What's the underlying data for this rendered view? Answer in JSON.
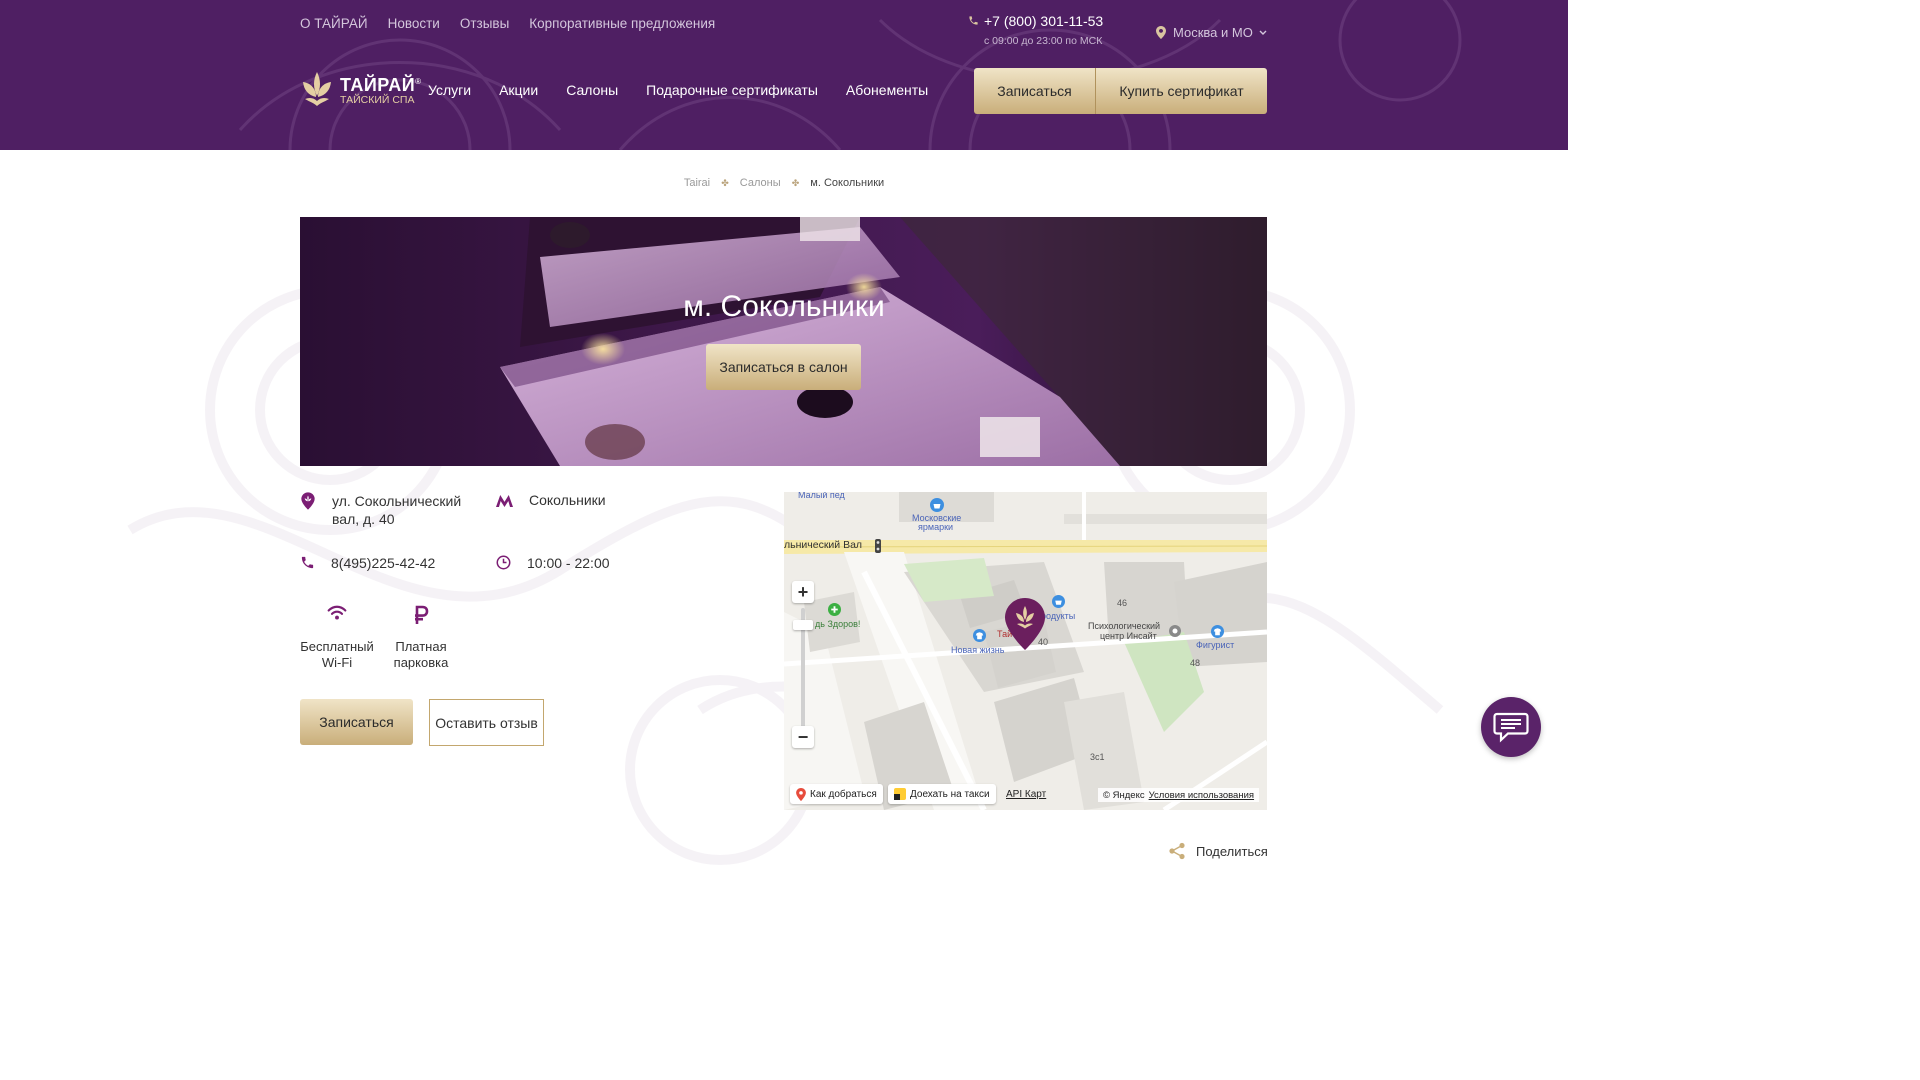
{
  "top_nav": [
    "О ТАЙРАЙ",
    "Новости",
    "Отзывы",
    "Корпоративные предложения"
  ],
  "contact": {
    "phone": "+7 (800) 301-11-53",
    "hours": "с 09:00 до 23:00 по МСК"
  },
  "city": "Москва и МО",
  "logo": {
    "name": "ТАЙРАЙ",
    "subtitle": "ТАЙСКИЙ СПА",
    "reg": "®"
  },
  "main_nav": [
    "Услуги",
    "Акции",
    "Салоны",
    "Подарочные сертификаты",
    "Абонементы"
  ],
  "header_buttons": {
    "signup": "Записаться",
    "buy_certificate": "Купить сертификат"
  },
  "breadcrumb": [
    "Tairai",
    "Салоны",
    "м. Сокольники"
  ],
  "hero": {
    "title": "м. Сокольники",
    "button": "Записаться в салон"
  },
  "salon": {
    "address_line1": "ул. Сокольнический",
    "address_line2": "вал, д. 40",
    "metro": "Сокольники",
    "phone": "8(495)225-42-42",
    "hours": "10:00 - 22:00",
    "amenities": [
      {
        "line1": "Бесплатный",
        "line2": "Wi-Fi",
        "icon": "wifi-icon"
      },
      {
        "line1": "Платная",
        "line2": "парковка",
        "icon": "ruble-icon"
      }
    ]
  },
  "actions": {
    "signup": "Записаться",
    "review": "Оставить отзыв"
  },
  "map": {
    "labels": {
      "street": "льнический Вал",
      "top_street": "Малый пед",
      "market_1": "Московские",
      "market_2": "ярмарки",
      "products": "родукты",
      "new_life": "Новая жизнь",
      "psych_1": "Психологический",
      "psych_2": "центр Инсайт",
      "figurist": "Фигурист",
      "health": "дь Здоров!",
      "tai": "Тай",
      "n40": "40",
      "n46": "46",
      "n48": "48",
      "n3c1": "3с1"
    },
    "route_label": "Как добраться",
    "taxi_label": "Доехать на такси",
    "api_label": "API Карт",
    "copyright": "© Яндекс",
    "terms": "Условия использования"
  },
  "share_label": "Поделиться",
  "colors": {
    "brand_purple": "#4f1f63",
    "gold": "#c9ae7a",
    "icon_purple": "#7b1e74"
  }
}
